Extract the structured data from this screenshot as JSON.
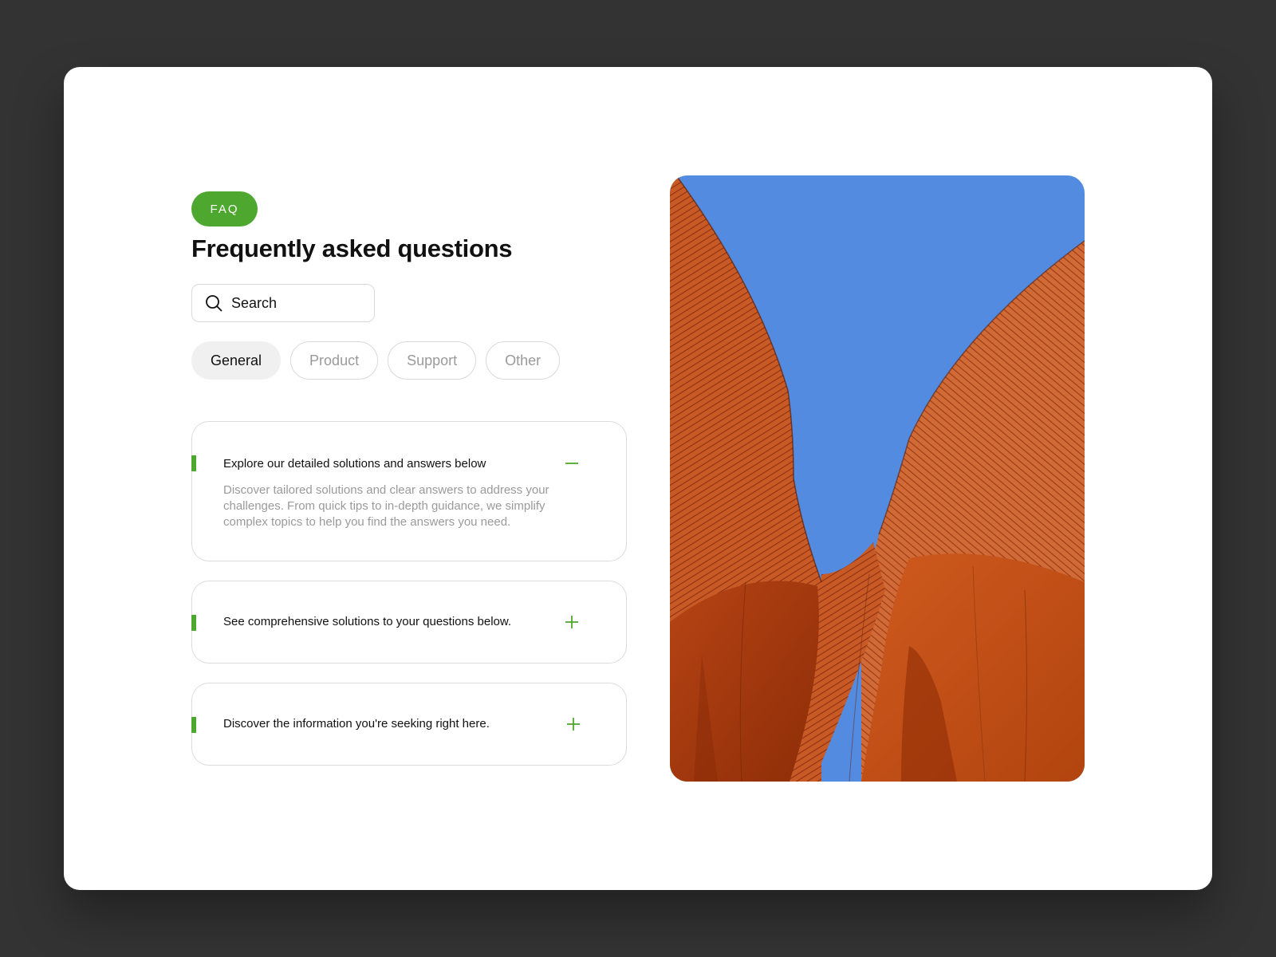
{
  "badge": {
    "label": "FAQ"
  },
  "page": {
    "title": "Frequently asked questions"
  },
  "search": {
    "placeholder": "Search"
  },
  "tabs": [
    {
      "label": "General",
      "active": true
    },
    {
      "label": "Product",
      "active": false
    },
    {
      "label": "Support",
      "active": false
    },
    {
      "label": "Other",
      "active": false
    }
  ],
  "faq": [
    {
      "question": "Explore our detailed solutions and answers below",
      "answer": "Discover tailored solutions and clear answers to address your challenges. From quick tips to in-depth guidance, we simplify complex topics to help you find the answers you need.",
      "expanded": true,
      "icon": "minus-icon"
    },
    {
      "question": "See comprehensive solutions to your questions below.",
      "expanded": false,
      "icon": "plus-icon"
    },
    {
      "question": "Discover the information you're seeking right here.",
      "expanded": false,
      "icon": "plus-icon"
    }
  ],
  "image": {
    "subject": "orange architectural facade against blue sky"
  },
  "colors": {
    "accent": "#4ea72e",
    "background": "#333333",
    "card": "#ffffff",
    "sky": "#528be0",
    "facade": "#c9521c"
  }
}
